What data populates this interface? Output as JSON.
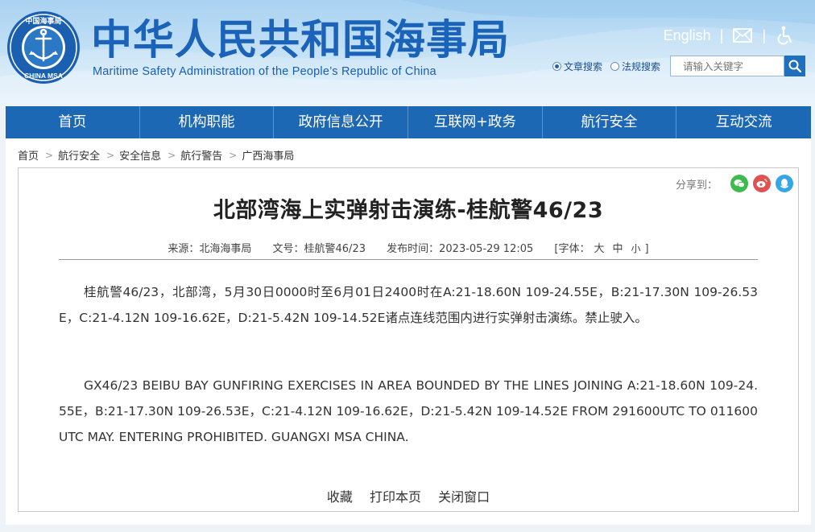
{
  "header": {
    "title_cn": "中华人民共和国海事局",
    "title_en": "Maritime Safety Administration of the People’s Republic of China",
    "logo_text_top": "中国海事局",
    "logo_text_bottom": "CHINA MSA",
    "english_link": "English",
    "separator": "|",
    "mail_icon": "mail-icon",
    "accessibility_icon": "accessibility-icon"
  },
  "search": {
    "radio_articles": "文章搜索",
    "radio_regulations": "法规搜索",
    "placeholder": "请输入关键字",
    "selected": "文章搜索"
  },
  "nav": {
    "items": [
      "首页",
      "机构职能",
      "政府信息公开",
      "互联网+政务",
      "航行安全",
      "互动交流"
    ]
  },
  "breadcrumb": [
    "首页",
    "航行安全",
    "安全信息",
    "航行警告",
    "广西海事局"
  ],
  "share": {
    "label": "分享到：",
    "icons": [
      "wechat-icon",
      "weibo-icon",
      "qq-icon"
    ]
  },
  "article": {
    "title": "北部湾海上实弹射击演练-桂航警46/23",
    "source": "来源：北海海事局",
    "doc_no": "文号：桂航警46/23",
    "published": "发布时间：2023-05-29 12:05",
    "font_label": "[字体：",
    "font_large": "大",
    "font_medium": "中",
    "font_small": "小",
    "font_close": "]",
    "para_cn": "桂航警46/23，北部湾，5月30日0000时至6月01日2400时在A:21-18.60N 109-24.55E，B:21-17.30N 109-26.53E，C:21-4.12N 109-16.62E，D:21-5.42N 109-14.52E诸点连线范围内进行实弹射击演练。禁止驶入。",
    "para_en": "GX46/23 BEIBU BAY GUNFIRING EXERCISES IN AREA BOUNDED BY THE LINES JOINING A:21-18.60N 109-24.55E，B:21-17.30N 109-26.53E，C:21-4.12N 109-16.62E，D:21-5.42N 109-14.52E FROM 291600UTC TO 011600UTC MAY. ENTERING PROHIBITED. GUANGXI MSA CHINA."
  },
  "actions": {
    "favorite": "收藏",
    "print": "打印本页",
    "close": "关闭窗口"
  },
  "colors": {
    "nav_bg": "#1c68b5",
    "title_blue": "#1a63b8",
    "wechat": "#3dbb4c",
    "weibo": "#e0524f",
    "qq": "#35a6e8"
  }
}
